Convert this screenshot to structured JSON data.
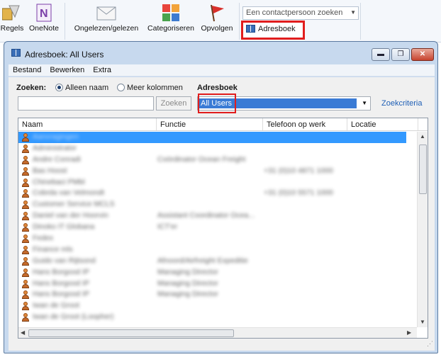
{
  "ribbon": {
    "regels": "Regels",
    "onenote": "OneNote",
    "ongelezen": "Ongelezen/gelezen",
    "categoriseren": "Categoriseren",
    "opvolgen": "Opvolgen",
    "contact_search": "Een contactpersoon zoeken",
    "adresboek": "Adresboek"
  },
  "dialog": {
    "title": "Adresboek: All Users",
    "menu": [
      "Bestand",
      "Bewerken",
      "Extra"
    ],
    "zoeken_label": "Zoeken:",
    "radio_name_only": "Alleen naam",
    "radio_more_columns": "Meer kolommen",
    "adresboek_label": "Adresboek",
    "search_button": "Zoeken",
    "selected_addressbook": "All Users",
    "advanced_search": "Zoekcriteria",
    "columns": [
      "Naam",
      "Functie",
      "Telefoon op werk",
      "Locatie"
    ],
    "rows": [
      {
        "name": "Aanvragingen",
        "function": "",
        "phone": ""
      },
      {
        "name": "Administrator",
        "function": "",
        "phone": ""
      },
      {
        "name": "Andre Conradi",
        "function": "Coördinator Ocean Freight",
        "phone": ""
      },
      {
        "name": "Bas Hoost",
        "function": "",
        "phone": "+31 (0)10 4871 1000"
      },
      {
        "name": "Chinebaci PMbl",
        "function": "",
        "phone": ""
      },
      {
        "name": "Cobrda van Velmondt",
        "function": "",
        "phone": "+31 (0)10 5571 1000"
      },
      {
        "name": "Customer Service MCLS",
        "function": "",
        "phone": ""
      },
      {
        "name": "Daniel van der Hoorvin",
        "function": "Assistant Coordinator Ocea...",
        "phone": ""
      },
      {
        "name": "Dinoko IT Globana",
        "function": "ICT'er",
        "phone": ""
      },
      {
        "name": "Fedex",
        "function": "",
        "phone": ""
      },
      {
        "name": "Finance mls",
        "function": "",
        "phone": ""
      },
      {
        "name": "Guido van Rijtsond",
        "function": "Afnoord/Airfreight Expeditie",
        "phone": ""
      },
      {
        "name": "Hans Borgood IP",
        "function": "Managing Director",
        "phone": ""
      },
      {
        "name": "Hans Borgood IP",
        "function": "Managing Director",
        "phone": ""
      },
      {
        "name": "Hans Borgood IP",
        "function": "Managing Director",
        "phone": ""
      },
      {
        "name": "Iwan de Groot",
        "function": "",
        "phone": ""
      },
      {
        "name": "Iwan de Groot (Loopher)",
        "function": "",
        "phone": ""
      }
    ]
  },
  "icons": [
    "rules-icon",
    "onenote-icon",
    "envelope-icon",
    "categorize-icon",
    "flag-icon",
    "address-book-icon",
    "person-icon"
  ],
  "colors": {
    "highlight": "#e11d1d",
    "selection": "#3399ff",
    "link": "#1f5fb5"
  }
}
